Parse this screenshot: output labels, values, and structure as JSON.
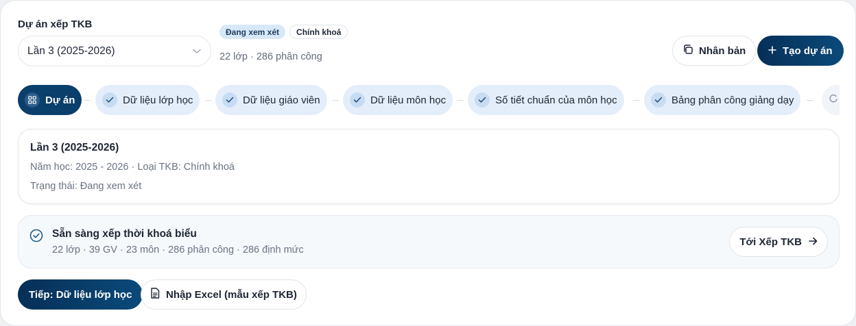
{
  "project": {
    "label": "Dự án xếp TKB",
    "selected": "Lần 3 (2025-2026)",
    "badges": [
      "Đang xem xét",
      "Chính khoá"
    ],
    "meta": "22 lớp · 286 phân công"
  },
  "actions": {
    "duplicate": "Nhân bản",
    "create": "Tạo dự án"
  },
  "steps": [
    {
      "label": "Dự án",
      "icon": "grid-icon",
      "active": true
    },
    {
      "label": "Dữ liệu lớp học",
      "icon": "check-icon"
    },
    {
      "label": "Dữ liệu giáo viên",
      "icon": "check-icon"
    },
    {
      "label": "Dữ liệu môn học",
      "icon": "check-icon"
    },
    {
      "label": "Số tiết chuẩn của môn học",
      "icon": "check-icon"
    },
    {
      "label": "Bảng phân công giảng dạy",
      "icon": "check-icon"
    }
  ],
  "info": {
    "title": "Lần 3 (2025-2026)",
    "year_line": "Năm học: 2025 - 2026 · Loại TKB: Chính khoá",
    "status_line": "Trạng thái: Đang xem xét"
  },
  "ready": {
    "title": "Sẵn sàng xếp thời khoá biểu",
    "summary": "22 lớp · 39 GV · 23 môn · 286 phân công · 286 định mức",
    "goto": "Tới Xếp TKB"
  },
  "footer": {
    "next": "Tiếp: Dữ liệu lớp học",
    "import": "Nhập Excel (mẫu xếp TKB)"
  },
  "colors": {
    "primary": "#0a3e6b",
    "step_bg": "#e4eefa",
    "badge_blue": "#d7e8f8"
  }
}
